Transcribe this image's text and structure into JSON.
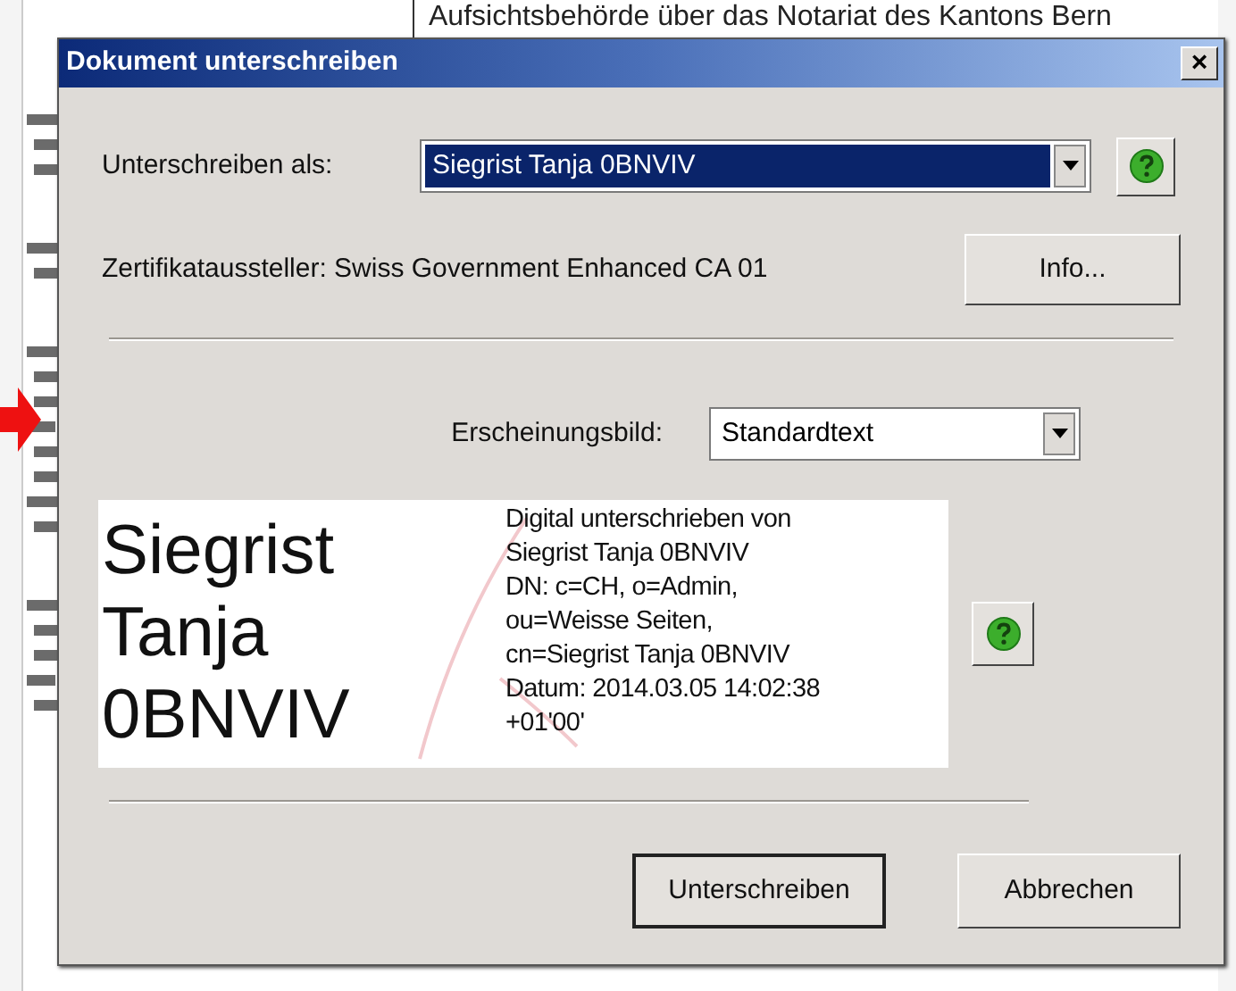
{
  "background_document": {
    "heading": "Aufsichtsbehörde über das Notariat des Kantons Bern"
  },
  "window": {
    "title": "Dokument unterschreiben",
    "close_label": "×"
  },
  "sign_as": {
    "label": "Unterschreiben als:",
    "value": "Siegrist Tanja 0BNVIV",
    "selected": true
  },
  "issuer": {
    "text": "Zertifikataussteller: Swiss Government Enhanced CA 01",
    "button": "Info..."
  },
  "appearance": {
    "label": "Erscheinungsbild:",
    "value": "Standardtext",
    "selected": false
  },
  "preview": {
    "name_lines": [
      "Siegrist",
      "Tanja",
      "0BNVIV"
    ],
    "details": [
      "Digital unterschrieben von",
      "Siegrist Tanja 0BNVIV",
      "DN: c=CH, o=Admin,",
      "ou=Weisse Seiten,",
      "cn=Siegrist Tanja 0BNVIV",
      "Datum: 2014.03.05 14:02:38",
      "+01'00'"
    ]
  },
  "buttons": [
    {
      "label": "Unterschreiben",
      "default": true
    },
    {
      "label": "Abbrechen",
      "default": false
    }
  ]
}
